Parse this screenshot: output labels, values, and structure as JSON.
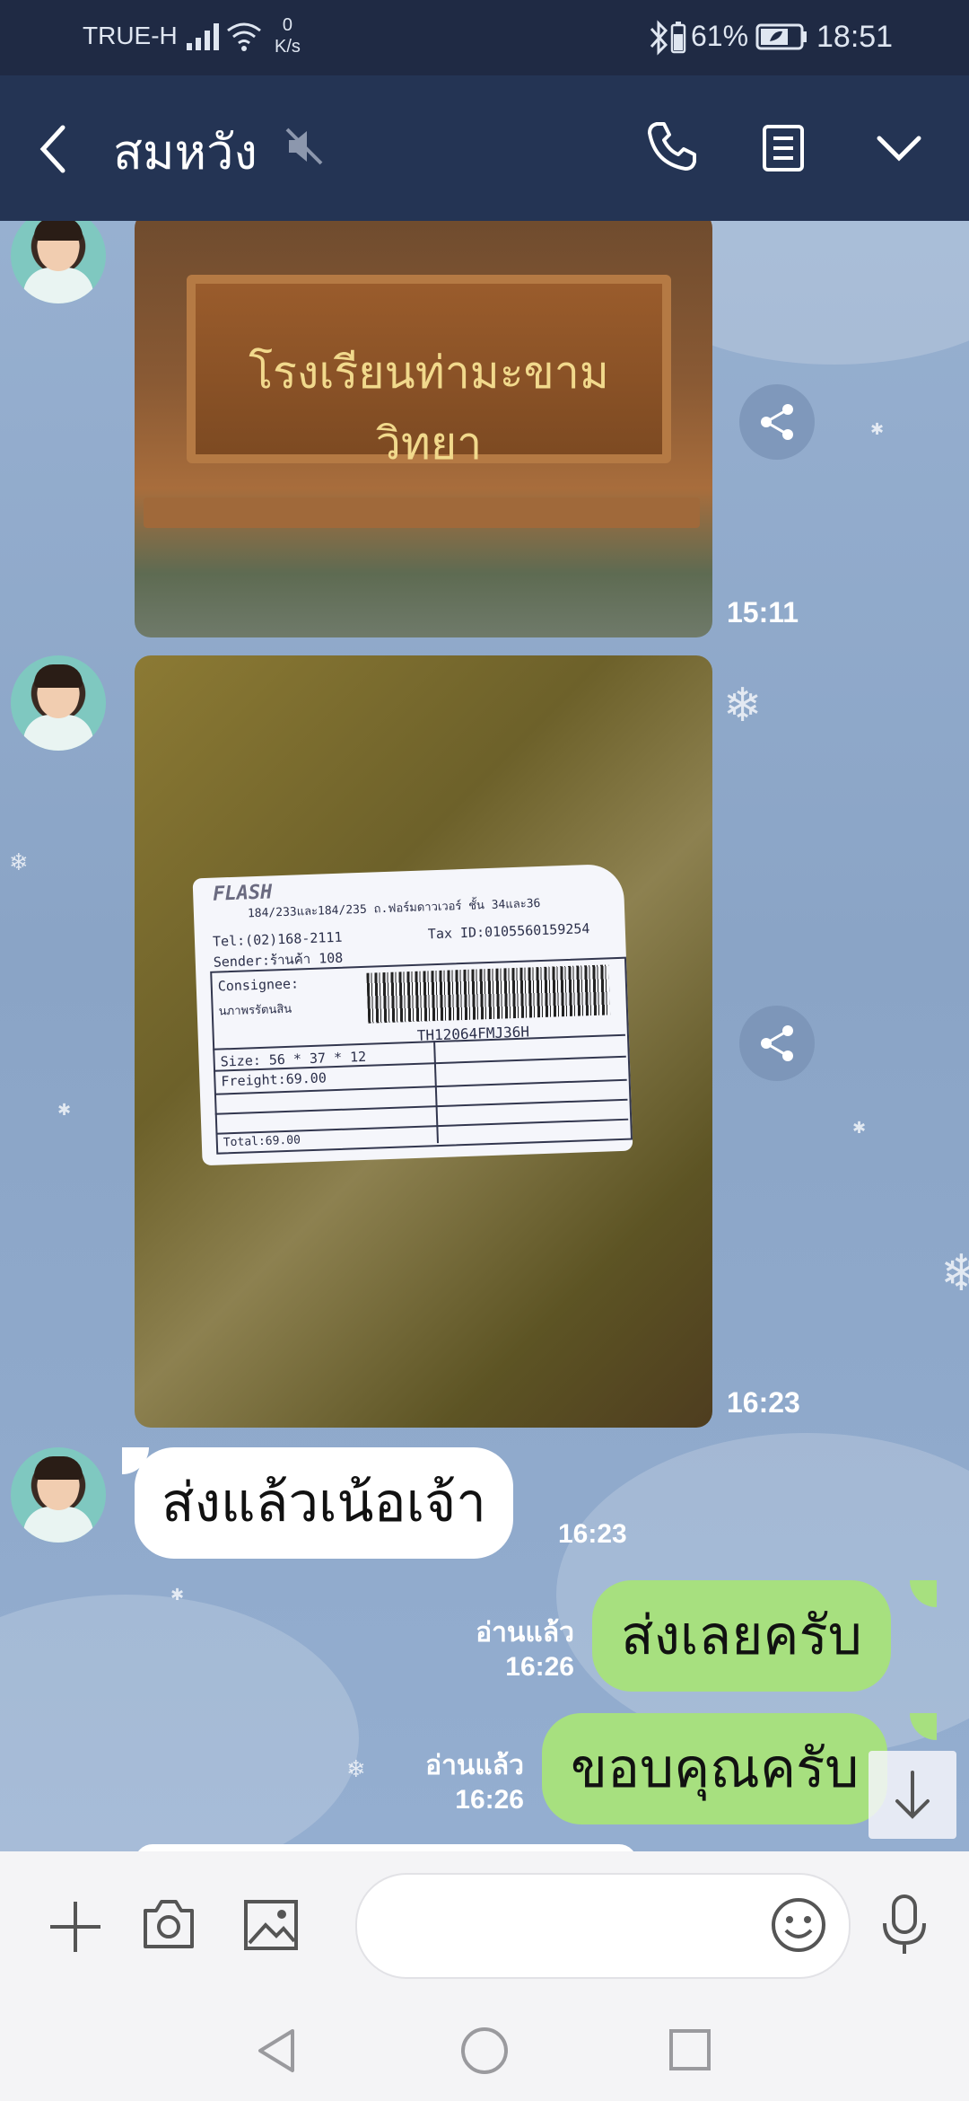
{
  "status_bar": {
    "carrier": "TRUE-H",
    "net_speed_value": "0",
    "net_speed_unit": "K/s",
    "battery_percent": "61%",
    "time": "18:51"
  },
  "header": {
    "title": "สมหวัง"
  },
  "messages": [
    {
      "type": "image",
      "sender": "other",
      "sign_text": "โรงเรียนท่ามะขามวิทยา",
      "time": "15:11"
    },
    {
      "type": "image",
      "sender": "other",
      "time": "16:23",
      "receipt": {
        "logo": "FLASH",
        "address_line": "184/233และ184/235 ถ.ฟอร์มดาวเวอร์ ชั้น 34และ36",
        "tel": "Tel:(02)168-2111",
        "tax_id": "Tax ID:0105560159254",
        "sender": "Sender:ร้านค้า 108",
        "consignee": "Consignee:",
        "consignee_name": "นภาพรรัตนสิน",
        "tracking": "TH12064FMJ36H",
        "size": "Size: 56 * 37 * 12",
        "freight": "Freight:69.00",
        "total": "Total:69.00"
      }
    },
    {
      "type": "text",
      "sender": "other",
      "text": "ส่งแล้วเน้อเจ้า",
      "time": "16:23"
    },
    {
      "type": "text",
      "sender": "me",
      "text": "ส่งเลยครับ",
      "read_label": "อ่านแล้ว",
      "time": "16:26"
    },
    {
      "type": "text",
      "sender": "me",
      "text": "ขอบคุณครับ",
      "read_label": "อ่านแล้ว",
      "time": "16:26"
    }
  ],
  "colors": {
    "status_bg": "#1f2a44",
    "header_bg": "#243454",
    "chat_bg": "#8ea8c9",
    "outgoing_bubble": "#a7e07f",
    "incoming_bubble": "#ffffff"
  },
  "icons": {
    "header": [
      "back-arrow-icon",
      "mute-icon",
      "phone-icon",
      "notes-icon",
      "chevron-down-icon"
    ],
    "input": [
      "plus-icon",
      "camera-icon",
      "image-icon",
      "emoji-icon",
      "microphone-icon"
    ],
    "nav": [
      "nav-back-icon",
      "nav-home-icon",
      "nav-recents-icon"
    ]
  }
}
